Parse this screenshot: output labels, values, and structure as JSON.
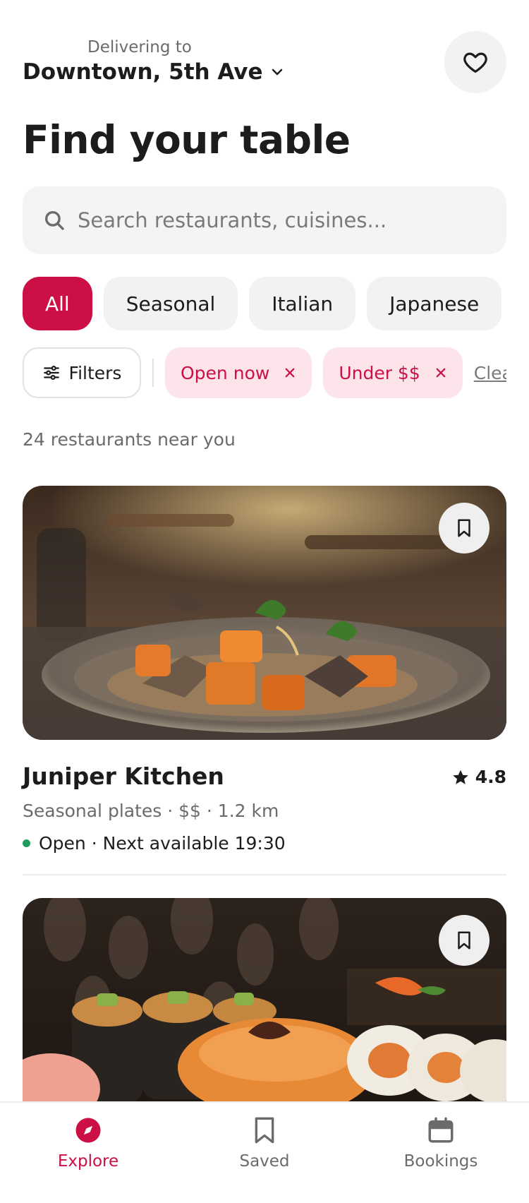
{
  "header": {
    "deliver_label": "Delivering to",
    "location": "Downtown, 5th Ave"
  },
  "title": "Find your table",
  "search": {
    "placeholder": "Search restaurants, cuisines..."
  },
  "categories": [
    {
      "label": "All",
      "active": true
    },
    {
      "label": "Seasonal",
      "active": false
    },
    {
      "label": "Italian",
      "active": false
    },
    {
      "label": "Japanese",
      "active": false
    }
  ],
  "filters": {
    "button_label": "Filters",
    "active_tags": [
      "Open now",
      "Under $$"
    ],
    "clear_label": "Clea"
  },
  "results_count": "24 restaurants near you",
  "restaurants": [
    {
      "name": "Juniper Kitchen",
      "rating": "4.8",
      "meta": "Seasonal plates · $$ · 1.2 km",
      "status": "Open · Next available 19:30"
    },
    {
      "name": "",
      "rating": "",
      "meta": "",
      "status": ""
    }
  ],
  "tabs": [
    {
      "label": "Explore",
      "icon": "compass-icon",
      "active": true
    },
    {
      "label": "Saved",
      "icon": "bookmark-icon",
      "active": false
    },
    {
      "label": "Bookings",
      "icon": "calendar-icon",
      "active": false
    }
  ],
  "colors": {
    "accent": "#cc0f45",
    "accent_soft": "#fde4ea",
    "open_status": "#1f9d5a"
  }
}
